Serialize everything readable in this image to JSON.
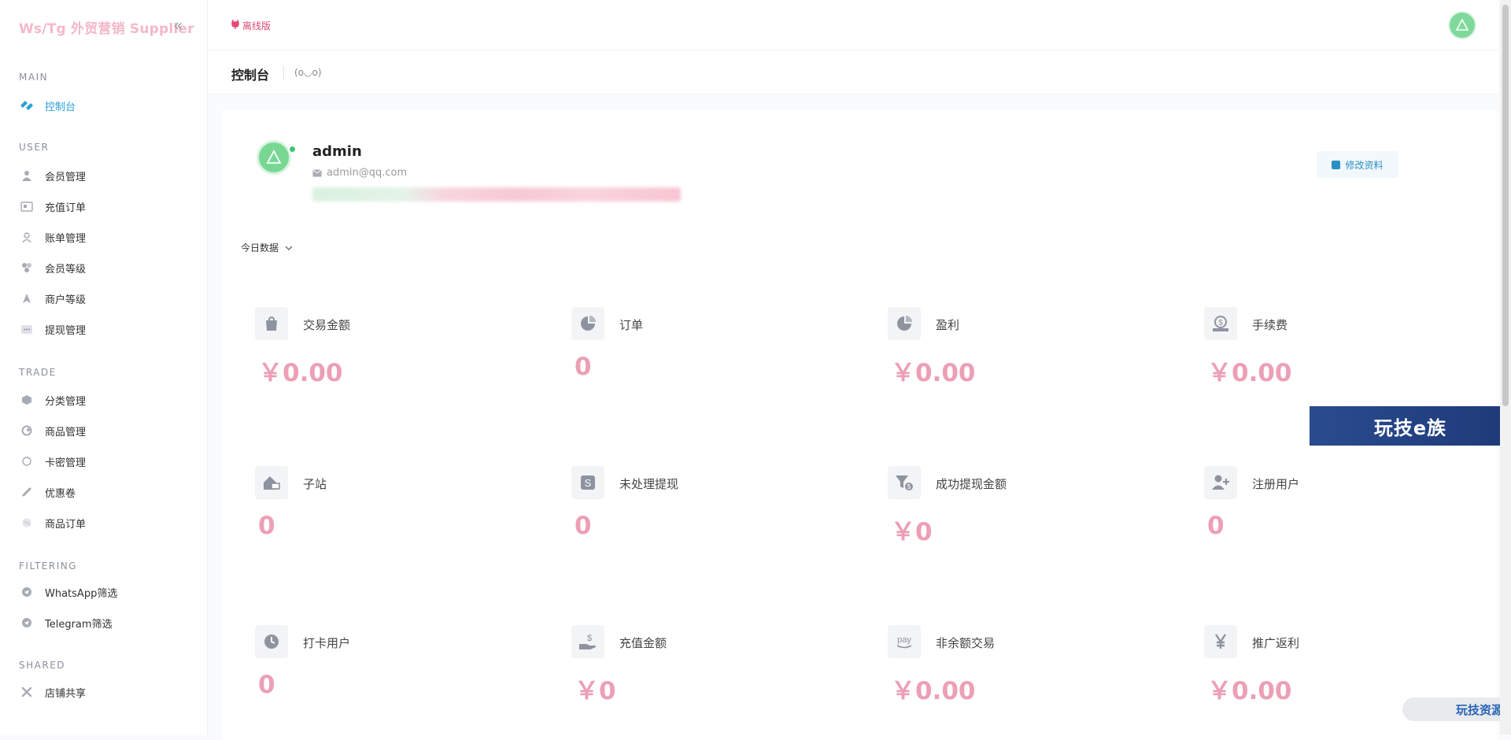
{
  "app": {
    "brand": "Ws/Tg 外贸营销 Supplier",
    "collapse_glyph": "«"
  },
  "sidebar": {
    "sections": [
      {
        "title": "MAIN",
        "items": [
          {
            "label": "控制台",
            "icon": "dashboard-icon",
            "active": true
          }
        ]
      },
      {
        "title": "USER",
        "items": [
          {
            "label": "会员管理",
            "icon": "user-icon"
          },
          {
            "label": "充值订单",
            "icon": "recharge-icon"
          },
          {
            "label": "账单管理",
            "icon": "bill-icon"
          },
          {
            "label": "会员等级",
            "icon": "level-icon"
          },
          {
            "label": "商户等级",
            "icon": "merchant-icon"
          },
          {
            "label": "提现管理",
            "icon": "withdraw-icon"
          }
        ]
      },
      {
        "title": "TRADE",
        "items": [
          {
            "label": "分类管理",
            "icon": "category-icon"
          },
          {
            "label": "商品管理",
            "icon": "product-icon"
          },
          {
            "label": "卡密管理",
            "icon": "card-icon"
          },
          {
            "label": "优惠卷",
            "icon": "coupon-icon"
          },
          {
            "label": "商品订单",
            "icon": "order-icon"
          }
        ]
      },
      {
        "title": "FILTERING",
        "items": [
          {
            "label": "WhatsApp筛选",
            "icon": "send-icon"
          },
          {
            "label": "Telegram筛选",
            "icon": "send-icon"
          }
        ]
      },
      {
        "title": "SHARED",
        "items": [
          {
            "label": "店铺共享",
            "icon": "share-icon"
          }
        ]
      }
    ]
  },
  "topbar": {
    "offline_label": "离线版"
  },
  "page": {
    "title": "控制台",
    "emoticon": "(o◡o)"
  },
  "profile": {
    "username": "admin",
    "email": "admin@qq.com",
    "edit_label": "修改资料"
  },
  "range": {
    "label": "今日数据"
  },
  "stats": [
    {
      "label": "交易金额",
      "value": "￥0.00",
      "icon": "bag-icon"
    },
    {
      "label": "订单",
      "value": "0",
      "icon": "pie-icon"
    },
    {
      "label": "盈利",
      "value": "￥0.00",
      "icon": "pie-icon"
    },
    {
      "label": "手续费",
      "value": "￥0.00",
      "icon": "coin-icon"
    },
    {
      "label": "子站",
      "value": "0",
      "icon": "house-icon"
    },
    {
      "label": "未处理提现",
      "value": "0",
      "icon": "dollar-icon"
    },
    {
      "label": "成功提现金额",
      "value": "￥0",
      "icon": "funnel-icon"
    },
    {
      "label": "注册用户",
      "value": "0",
      "icon": "add-user-icon"
    },
    {
      "label": "打卡用户",
      "value": "0",
      "icon": "clock-icon"
    },
    {
      "label": "充值金额",
      "value": "￥0",
      "icon": "hand-money-icon"
    },
    {
      "label": "非余额交易",
      "value": "￥0.00",
      "icon": "pay-icon"
    },
    {
      "label": "推广返利",
      "value": "￥0.00",
      "icon": "yen-icon"
    }
  ],
  "watermarks": {
    "banner": "玩技e族",
    "badge": "玩技资源"
  },
  "colors": {
    "accent": "#2a9fd6",
    "value_pink": "#ec9fb5",
    "brand_pink": "#f4b8c8",
    "offline_red": "#e04a74",
    "online_green": "#3fc573"
  }
}
